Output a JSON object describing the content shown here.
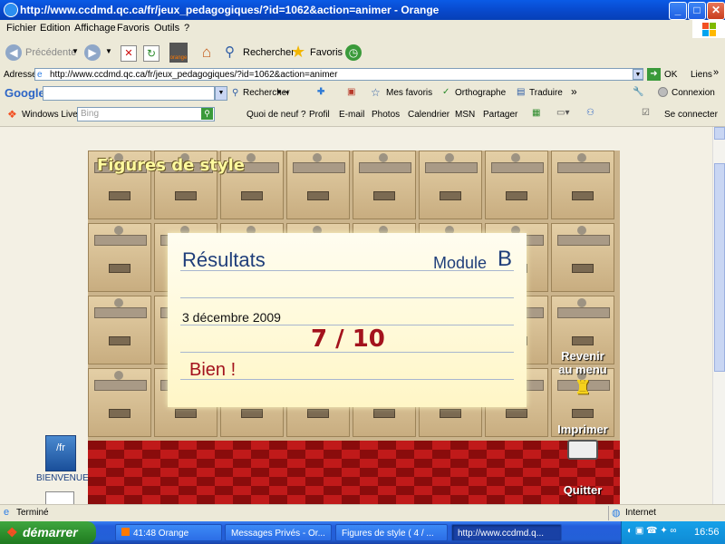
{
  "window": {
    "title": "http://www.ccdmd.qc.ca/fr/jeux_pedagogiques/?id=1062&action=animer - Orange",
    "buttons": {
      "minimize": "_",
      "maximize": "□",
      "close": "✕"
    }
  },
  "menu": [
    "Fichier",
    "Edition",
    "Affichage",
    "Favoris",
    "Outils",
    "?"
  ],
  "toolbar": {
    "back_label": "Précédente",
    "brand_label": "orange",
    "search_label": "Rechercher",
    "favorites_label": "Favoris"
  },
  "address": {
    "label": "Adresse",
    "url": "http://www.ccdmd.qc.ca/fr/jeux_pedagogiques/?id=1062&action=animer",
    "go_label": "OK",
    "links_label": "Liens"
  },
  "google_bar": {
    "logo": "Google",
    "search_value": "",
    "rechercher": "Rechercher",
    "mes_favoris": "Mes favoris",
    "orthographe": "Orthographe",
    "traduire": "Traduire",
    "connexion": "Connexion"
  },
  "live_bar": {
    "logo": "Windows Live",
    "search_placeholder": "Bing",
    "items": [
      "Quoi de neuf ?",
      "Profil",
      "E-mail",
      "Photos",
      "Calendrier",
      "MSN",
      "Partager"
    ],
    "signin": "Se connecter"
  },
  "game": {
    "title": "Figures de style",
    "card": {
      "heading": "Résultats",
      "module_label": "Module",
      "module_value": "B",
      "date": "3 décembre 2009",
      "score": "7 / 10",
      "comment": "Bien !"
    },
    "menu_label_line1": "Revenir",
    "menu_label_line2": "au menu",
    "print_label": "Imprimer",
    "quit_label": "Quitter",
    "welcome_icon": "/fr",
    "welcome_label": "BIENVENUE"
  },
  "status": {
    "text": "Terminé",
    "zone": "Internet"
  },
  "taskbar": {
    "start": "démarrer",
    "tasks": [
      {
        "label": "41:48 Orange"
      },
      {
        "label": "Messages Privés - Or..."
      },
      {
        "label": "Figures de style ( 4 / ..."
      },
      {
        "label": "http://www.ccdmd.q..."
      }
    ],
    "clock": "16:56"
  },
  "colors": {
    "titlebar": "#0a5be6",
    "card": "#fff8d8",
    "score": "#a3121d",
    "floor": "#c01a1a"
  },
  "icons": [
    "ie-icon",
    "back-arrow-icon",
    "forward-arrow-icon",
    "stop-icon",
    "refresh-icon",
    "home-icon",
    "search-icon",
    "favorites-star-icon",
    "history-icon",
    "go-arrow-icon",
    "printer-icon",
    "trophy-icon",
    "welcome-icon"
  ]
}
